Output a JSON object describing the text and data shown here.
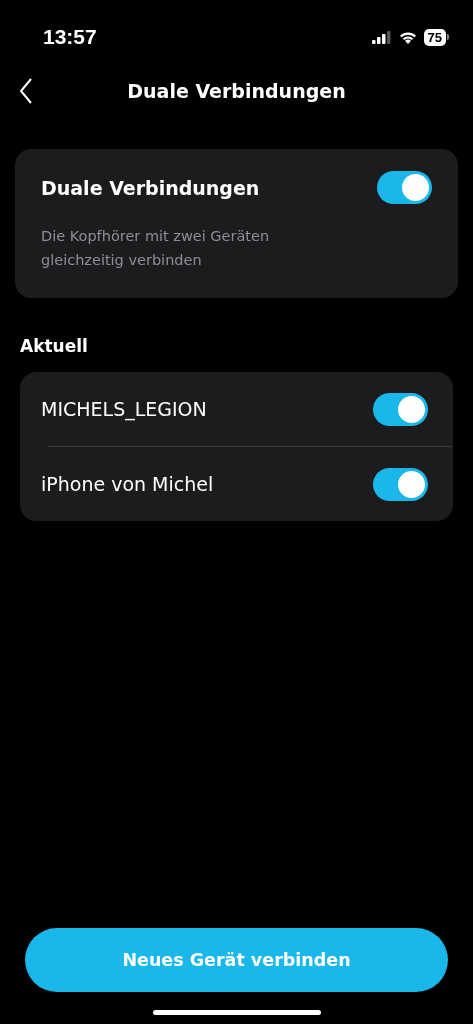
{
  "status_bar": {
    "time": "13:57",
    "battery": "75"
  },
  "nav": {
    "title": "Duale Verbindungen"
  },
  "feature": {
    "title": "Duale Verbindungen",
    "description": "Die Kopfhörer mit zwei Geräten gleichzeitig verbinden",
    "on": true
  },
  "section": {
    "title": "Aktuell"
  },
  "devices": [
    {
      "name": "MICHELS_LEGION",
      "on": true
    },
    {
      "name": "iPhone von Michel",
      "on": true
    }
  ],
  "primary_button": {
    "label": "Neues Gerät verbinden"
  }
}
